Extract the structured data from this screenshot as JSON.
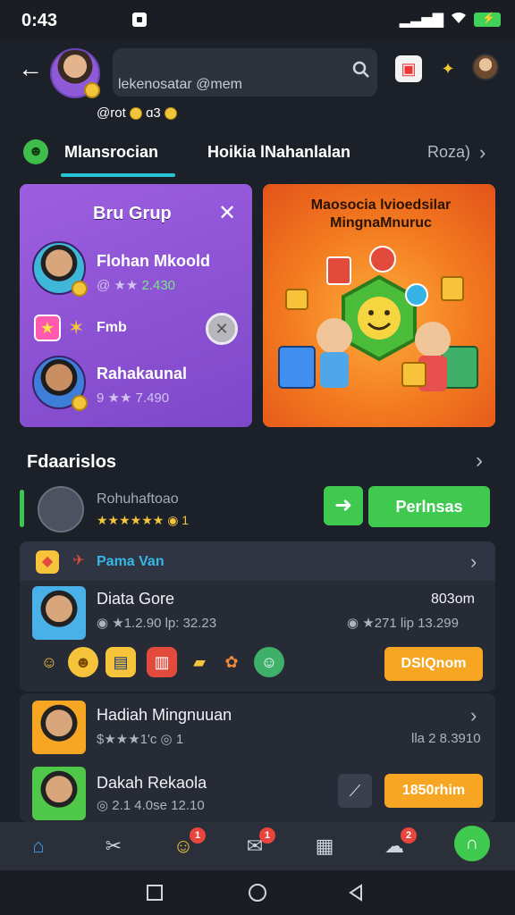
{
  "status_bar": {
    "time": "0:43"
  },
  "header": {
    "search_title": "",
    "search_subtitle": "lekenosatar @mem",
    "balance": "@rot",
    "balance_suffix": "ɑ3"
  },
  "tabs": [
    {
      "label": "Mlansrocian",
      "active": true
    },
    {
      "label": "Hoikia lNahanlalan",
      "active": false
    },
    {
      "label": "Roza)",
      "active": false
    }
  ],
  "group_card": {
    "title": "Bru Grup",
    "members": [
      {
        "name": "Flohan Mkoold",
        "meta_prefix": "@ ★★",
        "meta_value": "2.430"
      },
      {
        "name": "Fmb",
        "meta_prefix": "",
        "meta_value": ""
      },
      {
        "name": "Rahakaunal",
        "meta_prefix": "9 ★★",
        "meta_value": "7.490"
      }
    ]
  },
  "promo_card": {
    "title_line1": "Maosocia lvioedsilar",
    "title_line2": "MingnaMnuruc"
  },
  "friends": {
    "title": "Fdaarislos",
    "friend": {
      "name": "Rohuhaftoao",
      "stars": "★★★★★★ ◉ 1"
    },
    "invite_label": "Perlnsas"
  },
  "panel": {
    "header_label": "Pama Van",
    "row1": {
      "title": "Diata Gore",
      "meta": "◉ ★1.2.90  lp: 32.23",
      "value": "803om",
      "sub": "◉ ★271  lip 13.299",
      "button": "DSlQnom"
    }
  },
  "panel2": {
    "row1": {
      "title": "Hadiah Mingnuuan",
      "meta": "$★★★1'c ◎ 1",
      "value": "lla 2 8.3910"
    },
    "row2": {
      "title": "Dakah Rekaola",
      "meta": "◎ 2.1 4.0se 12.10",
      "button": "1850rhim"
    }
  },
  "nav": {
    "badges": [
      "1",
      "1",
      "2"
    ]
  },
  "colors": {
    "accent_green": "#3fc94f",
    "accent_orange": "#f6a623",
    "accent_cyan": "#27c6d6",
    "card_purple": "#8e54d6",
    "card_orange": "#f2771f"
  }
}
